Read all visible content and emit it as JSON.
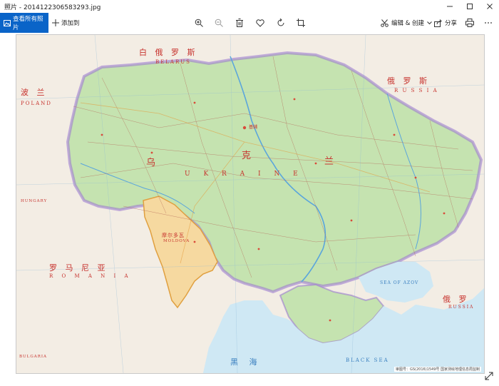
{
  "window": {
    "title": "照片 - 2014122306583293.jpg"
  },
  "toolbar": {
    "view_all_label": "查看所有照片",
    "add_label": "添加到",
    "edit_create_label": "编辑 & 创建",
    "share_label": "分享",
    "zoom_in_icon": "zoom-in-icon",
    "zoom_out_icon": "zoom-out-icon",
    "delete_icon": "trash-icon",
    "favorite_icon": "heart-icon",
    "rotate_icon": "rotate-icon",
    "crop_icon": "crop-icon",
    "print_icon": "printer-icon",
    "more_icon": "more-icon"
  },
  "map": {
    "labels": {
      "belarus_cn": "白 俄 罗 斯",
      "belarus_en": "BELARUS",
      "poland_cn": "波 兰",
      "poland_en": "POLAND",
      "russia_cn": "俄 罗 斯",
      "russia_en": "R U S S I A",
      "ukraine_cn_1": "乌",
      "ukraine_cn_2": "克",
      "ukraine_cn_3": "兰",
      "ukraine_en": "U K R A I N E",
      "moldova_cn": "摩尔多瓦",
      "moldova_en": "MOLDOVA",
      "romania_cn": "罗 马 尼 亚",
      "romania_en": "R O M A N I A",
      "black_sea_cn": "黑 海",
      "black_sea_en": "BLACK  SEA",
      "azov_en": "SEA OF AZOV",
      "russia_sw_cn": "俄 罗",
      "russia_sw_en": "RUSSIA",
      "hungary_en": "HUNGARY",
      "bulgaria_en": "BULGARIA",
      "kyiv": "基辅",
      "copyright": "审图号：GS(2016)1549号  国家测绘地理信息局监制"
    }
  },
  "colors": {
    "accent": "#0a64c8",
    "land_ukraine": "#c5e3b0",
    "land_moldova": "#f6d9a0",
    "land_neighbors": "#f3ede4",
    "sea": "#cfe8f4",
    "border_purple": "#9c7bd0",
    "label_red": "#c7332e",
    "label_blue": "#3a7fbf"
  }
}
